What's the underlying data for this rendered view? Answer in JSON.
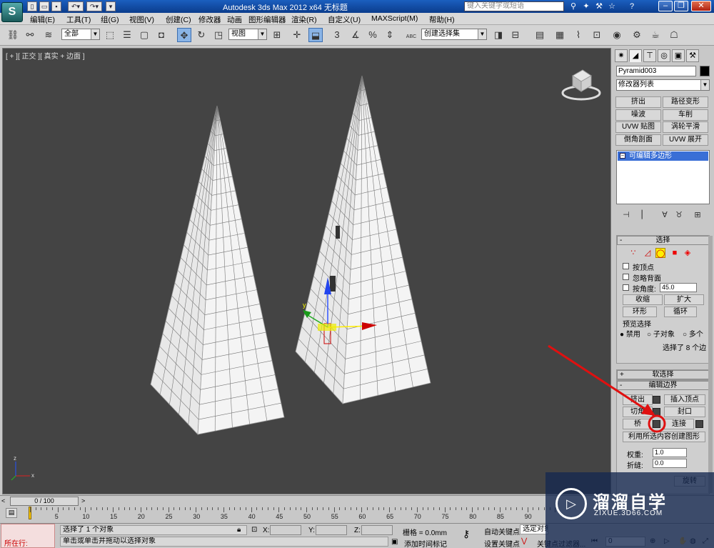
{
  "titlebar": {
    "logo": "S",
    "title": "Autodesk 3ds Max  2012 x64        无标题",
    "search_placeholder": "键入关键字或短语"
  },
  "menus": [
    "编辑(E)",
    "工具(T)",
    "组(G)",
    "视图(V)",
    "创建(C)",
    "修改器",
    "动画",
    "图形编辑器",
    "渲染(R)",
    "自定义(U)",
    "MAXScript(M)",
    "帮助(H)"
  ],
  "toolbar": {
    "selection_filter": "全部",
    "reference_coord": "视图",
    "named_selection": "创建选择集",
    "percent_snap_label": "%",
    "snap_3": "3",
    "text_abc": "ABC"
  },
  "viewport": {
    "label": "[ + ][ 正交 ][ 真实 + 边面 ]",
    "gizmo_axis_y": "y",
    "axis_x": "x",
    "axis_z": "z"
  },
  "command_panel": {
    "object_name": "Pyramid003",
    "modifier_list": "修改器列表",
    "modifier_buttons": [
      "挤出",
      "路径变形",
      "噪波",
      "车削",
      "UVW 贴图",
      "涡轮平滑",
      "倒角剖面",
      "UVW 展开"
    ],
    "stack_item": "可编辑多边形",
    "selection": {
      "title": "选择",
      "by_vertex": "按顶点",
      "ignore_backfacing": "忽略背面",
      "by_angle": "按角度:",
      "angle_value": "45.0",
      "shrink": "收缩",
      "grow": "扩大",
      "ring": "环形",
      "loop": "循环",
      "preview_title": "预览选择",
      "preview_off": "禁用",
      "preview_sub": "子对象",
      "preview_multi": "多个",
      "selected_info": "选择了 8 个边"
    },
    "soft_selection": "软选择",
    "edit_borders": {
      "title": "编辑边界",
      "extrude": "挤出",
      "insert_vertex": "插入顶点",
      "chamfer": "切角",
      "cap": "封口",
      "bridge": "桥",
      "connect": "连接",
      "create_shape": "利用所选内容创建图形",
      "weight_label": "权重:",
      "weight_value": "1.0",
      "crease_label": "折缝:",
      "crease_value": "0.0",
      "rotate": "旋转"
    }
  },
  "timeline": {
    "frame_display": "0 / 100",
    "ticks": [
      "5",
      "10",
      "15",
      "20",
      "25",
      "30",
      "35",
      "40",
      "45",
      "50",
      "55",
      "60",
      "65",
      "70",
      "75",
      "80",
      "85",
      "90"
    ]
  },
  "status": {
    "script_label": "所在行:",
    "selected_text": "选择了 1 个对象",
    "prompt_text": "单击或单击并拖动以选择对象",
    "x_label": "X:",
    "y_label": "Y:",
    "z_label": "Z:",
    "grid": "栅格 = 0.0mm",
    "add_time_tag": "添加时间标记",
    "auto_key": "自动关键点",
    "selected_object": "选定对象",
    "set_key": "设置关键点",
    "key_filters": "关键点过滤器...",
    "frame_value": "0"
  },
  "watermark": {
    "brand": "溜溜自学",
    "url": "ZIXUE.3D66.COM"
  },
  "colors": {
    "viewport_bg": "#444444",
    "titlebar": "#1b5fbf",
    "selected_stack": "#3a6fd6",
    "annotation_red": "#e01010"
  }
}
